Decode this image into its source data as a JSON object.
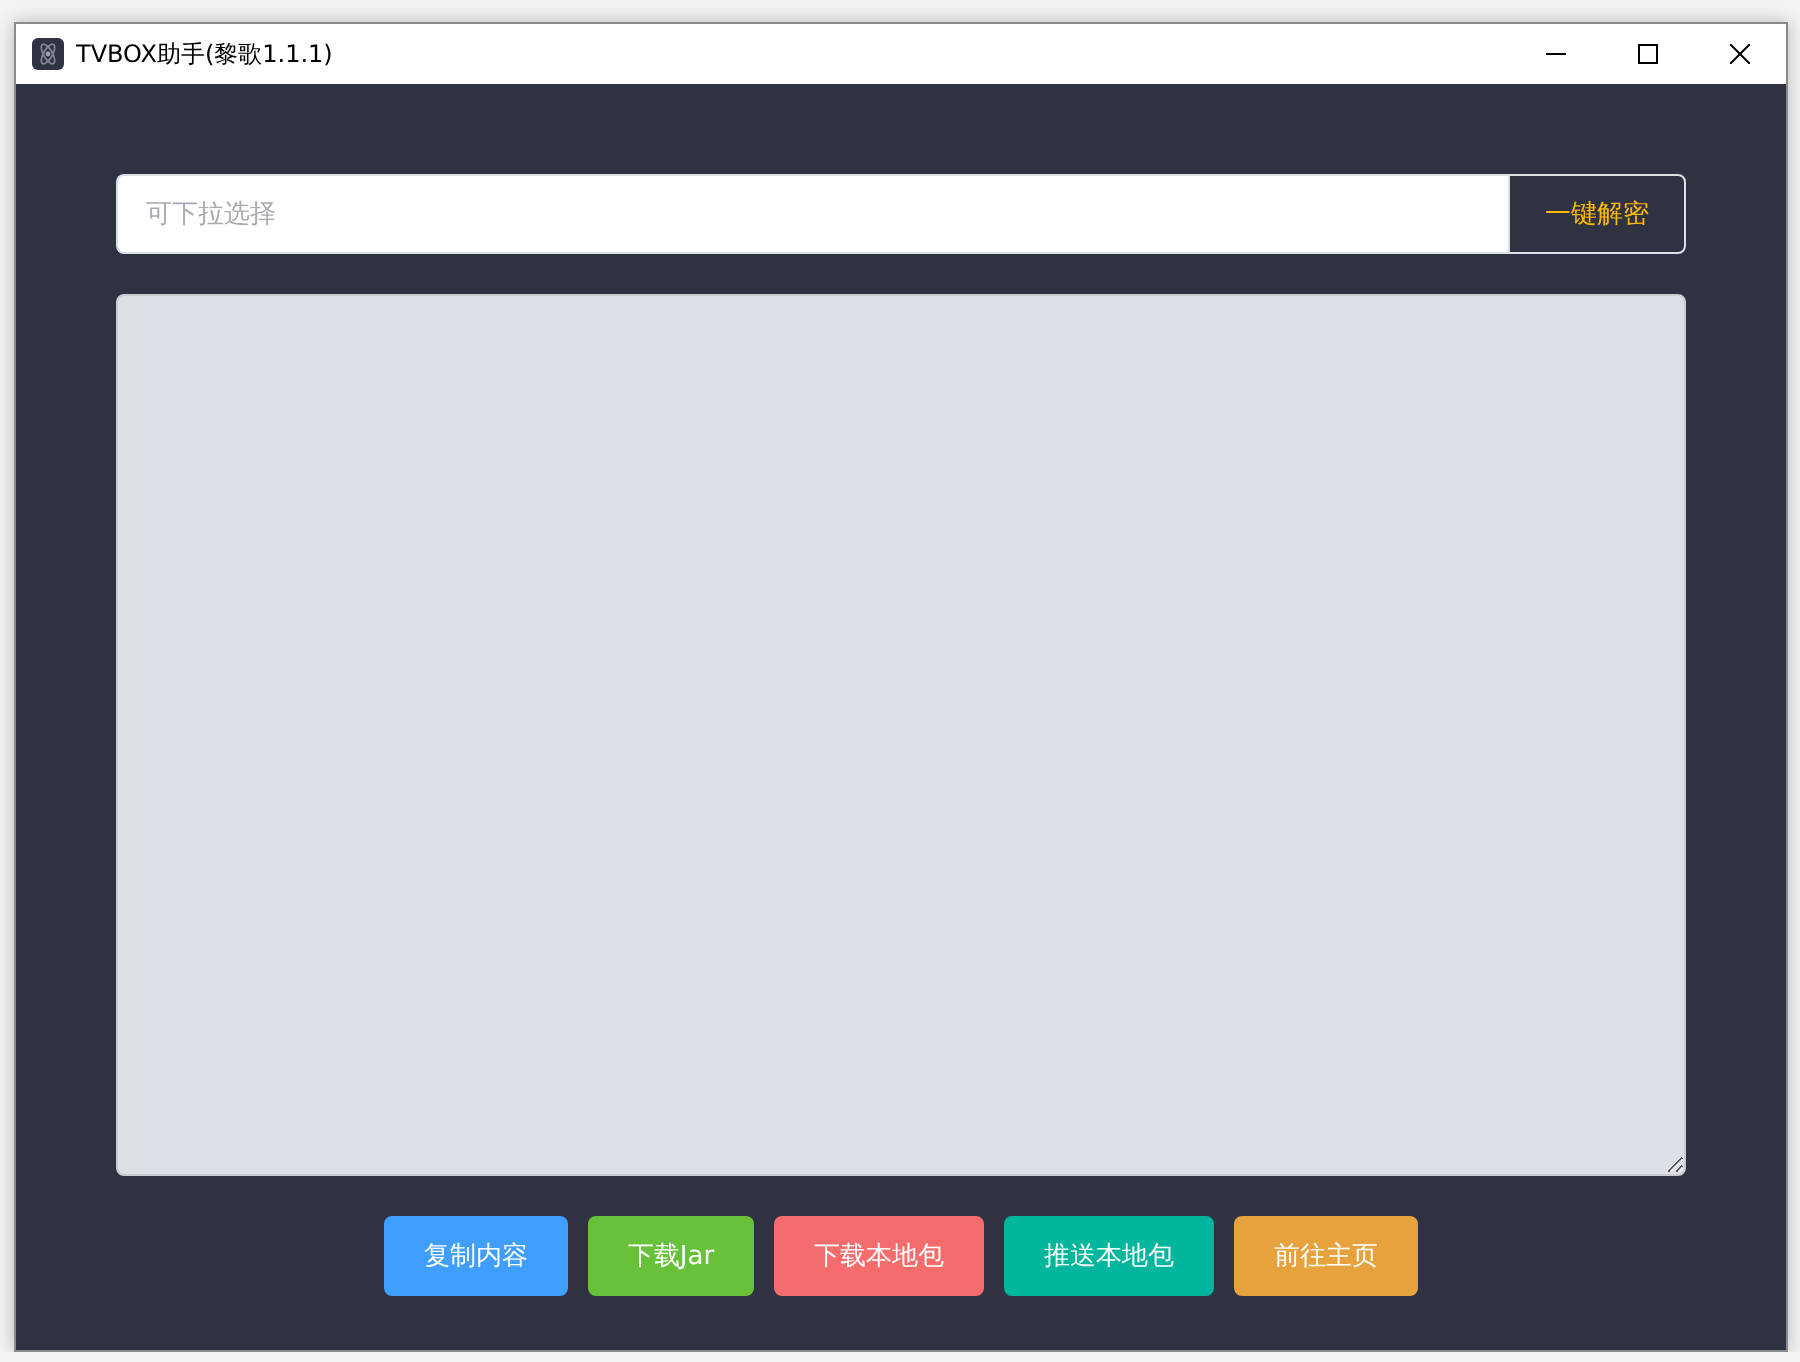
{
  "window": {
    "title": "TVBOX助手(黎歌1.1.1)"
  },
  "source_field": {
    "placeholder": "可下拉选择"
  },
  "decrypt_button": {
    "label": "一键解密"
  },
  "buttons": [
    {
      "label": "复制内容",
      "color": "#409eff"
    },
    {
      "label": "下载Jar",
      "color": "#67c23a"
    },
    {
      "label": "下载本地包",
      "color": "#f56c6c"
    },
    {
      "label": "推送本地包",
      "color": "#00b69c"
    },
    {
      "label": "前往主页",
      "color": "#e6a23c"
    }
  ]
}
